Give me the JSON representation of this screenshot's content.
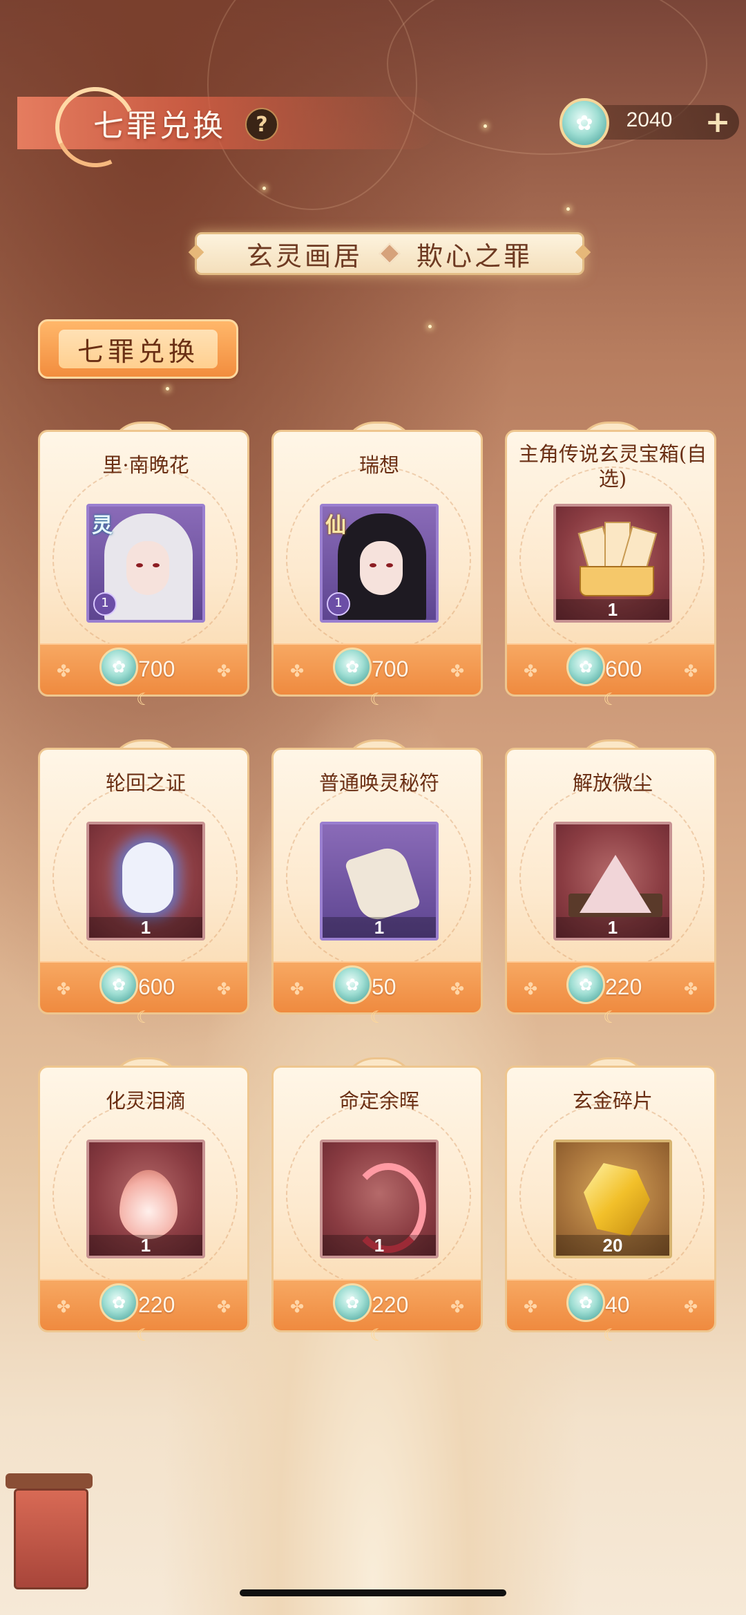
{
  "header": {
    "title": "七罪兑换",
    "help_label": "?",
    "currency": {
      "icon": "jade-currency-icon",
      "amount": "2040",
      "add_label": "+"
    }
  },
  "sub_banner": {
    "left": "玄灵画居",
    "right": "欺心之罪"
  },
  "section_tab": {
    "label": "七罪兑换"
  },
  "items": [
    {
      "name": "里·南晚花",
      "thumb_type": "character",
      "rarity": "灵",
      "level": "1",
      "price": "700"
    },
    {
      "name": "瑞想",
      "thumb_type": "character",
      "rarity": "仙",
      "level": "1",
      "price": "700"
    },
    {
      "name": "主角传说玄灵宝箱(自选)",
      "thumb_type": "chest",
      "quantity": "1",
      "price": "600"
    },
    {
      "name": "轮回之证",
      "thumb_type": "mask",
      "quantity": "1",
      "price": "600"
    },
    {
      "name": "普通唤灵秘符",
      "thumb_type": "scroll",
      "quantity": "1",
      "price": "50"
    },
    {
      "name": "解放微尘",
      "thumb_type": "dust",
      "quantity": "1",
      "price": "220"
    },
    {
      "name": "化灵泪滴",
      "thumb_type": "tear",
      "quantity": "1",
      "price": "220"
    },
    {
      "name": "命定余晖",
      "thumb_type": "swirl",
      "quantity": "1",
      "price": "220"
    },
    {
      "name": "玄金碎片",
      "thumb_type": "gold-shard",
      "quantity": "20",
      "price": "40"
    }
  ],
  "colors": {
    "accent_orange": "#ef8a3f",
    "title_text": "#6a2f14",
    "currency_teal": "#3f9c95"
  }
}
